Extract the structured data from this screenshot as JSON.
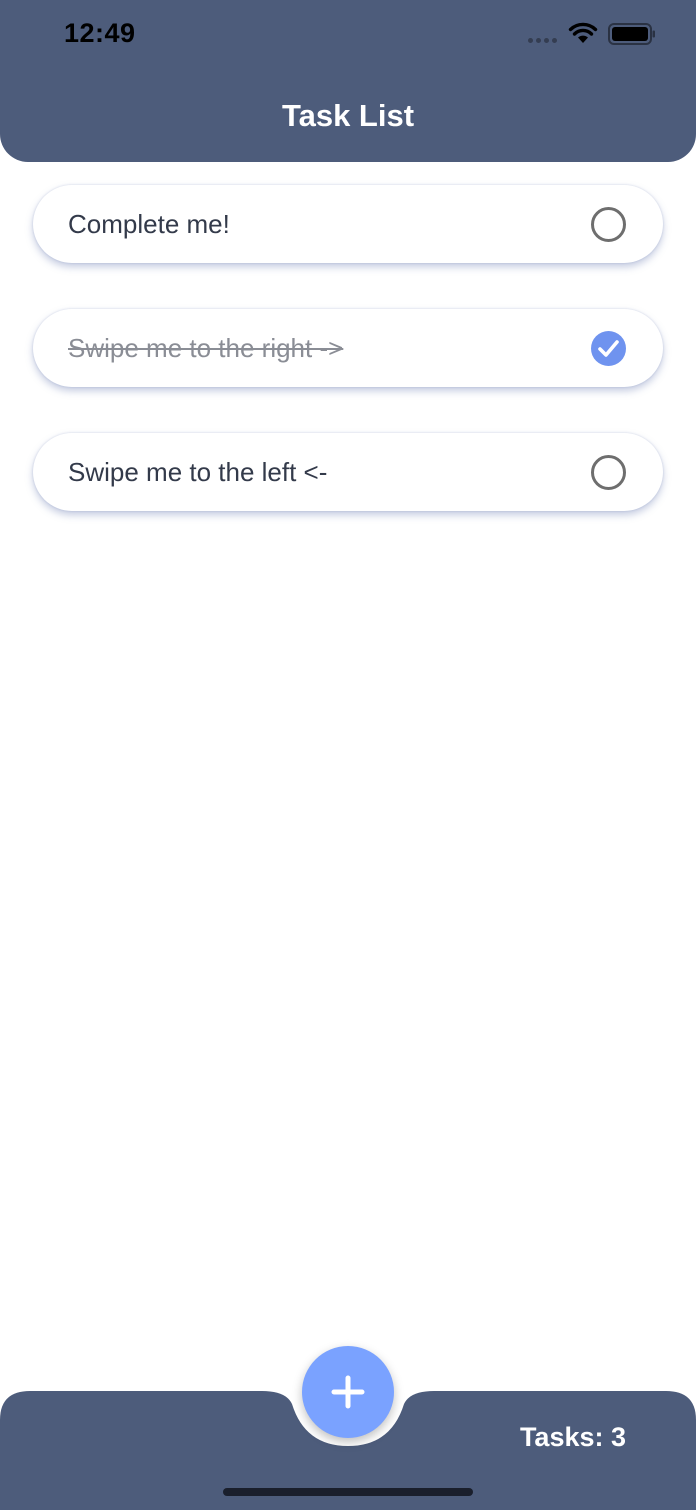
{
  "status_bar": {
    "time": "12:49"
  },
  "header": {
    "title": "Task List"
  },
  "tasks": [
    {
      "label": "Complete me!",
      "completed": false
    },
    {
      "label": "Swipe me to the right ->",
      "completed": true
    },
    {
      "label": "Swipe me to the left <-",
      "completed": false
    }
  ],
  "footer": {
    "task_count": "Tasks: 3"
  },
  "colors": {
    "header_bg": "#4d5c7b",
    "accent": "#7aa2ff",
    "check_blue": "#6f93ef"
  },
  "icons": {
    "fab": "plus-icon",
    "checked": "checkmark-icon",
    "unchecked": "empty-circle-icon"
  }
}
